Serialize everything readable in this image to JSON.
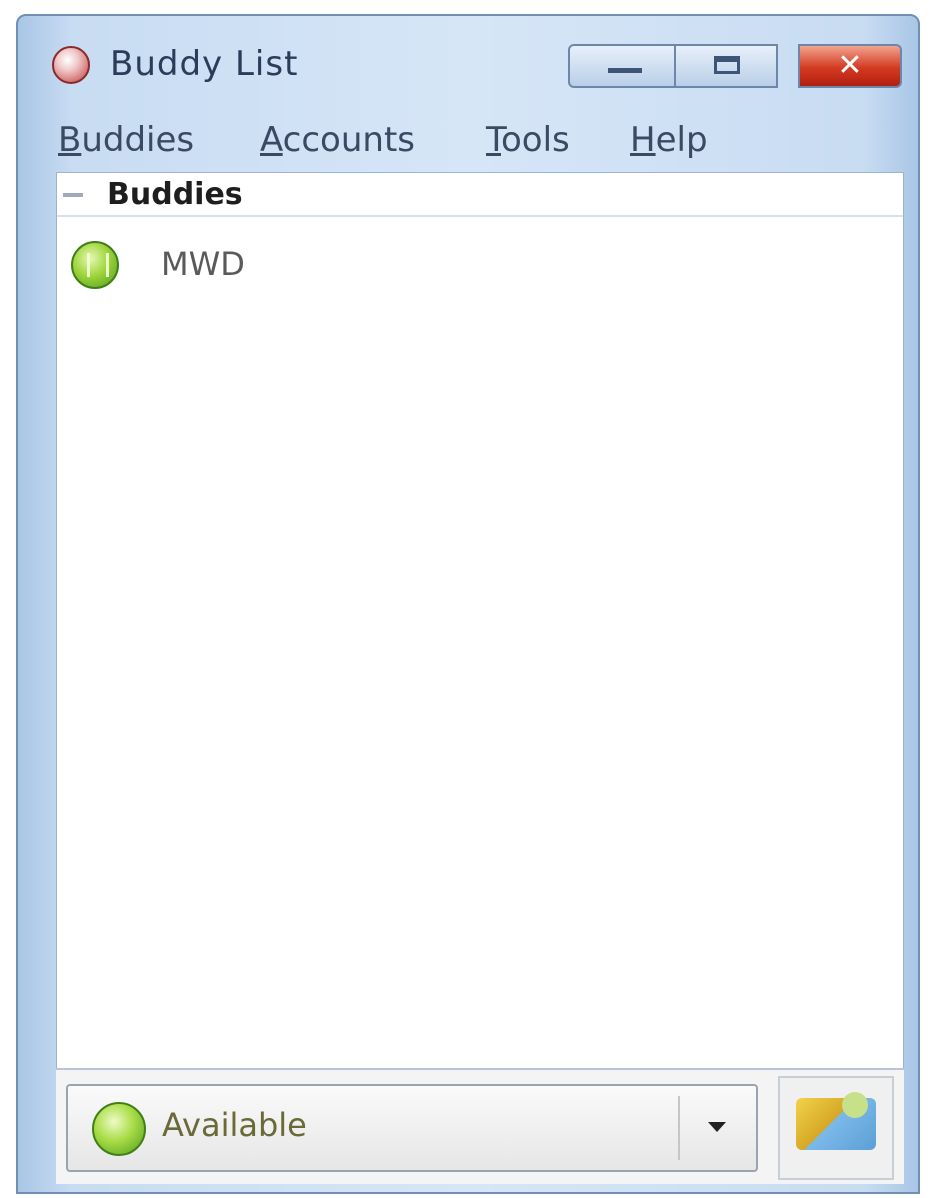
{
  "window": {
    "title": "Buddy List",
    "close_glyph": "✕"
  },
  "menu": {
    "items": [
      {
        "mnemonic": "B",
        "rest": "uddies"
      },
      {
        "mnemonic": "A",
        "rest": "ccounts"
      },
      {
        "mnemonic": "T",
        "rest": "ools"
      },
      {
        "mnemonic": "H",
        "rest": "elp"
      }
    ]
  },
  "buddy_list": {
    "group": {
      "label": "Buddies",
      "icon": "collapse-icon"
    },
    "buddies": [
      {
        "name": "MWD",
        "icon": "available-icon"
      }
    ]
  },
  "status": {
    "label": "Available",
    "icon": "available-status-icon"
  },
  "colors": {
    "available_green": "#9fd63c",
    "close_red": "#d33a22"
  }
}
